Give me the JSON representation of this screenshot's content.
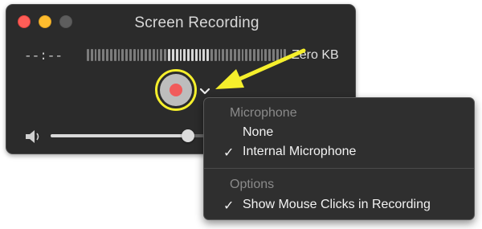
{
  "window": {
    "title": "Screen Recording",
    "time": "--:--",
    "file_size": "Zero KB",
    "volume": 0.55
  },
  "record_button": {
    "icon": "record-dot-icon"
  },
  "menu": {
    "sections": [
      {
        "header": "Microphone",
        "items": [
          {
            "label": "None",
            "checked": false
          },
          {
            "label": "Internal Microphone",
            "checked": true
          }
        ]
      },
      {
        "header": "Options",
        "items": [
          {
            "label": "Show Mouse Clicks in Recording",
            "checked": true
          }
        ]
      }
    ],
    "check_glyph": "✓"
  },
  "colors": {
    "record_red": "#f15b5b",
    "highlight_yellow": "#f5ef2c",
    "window_bg": "#2b2b2b"
  }
}
